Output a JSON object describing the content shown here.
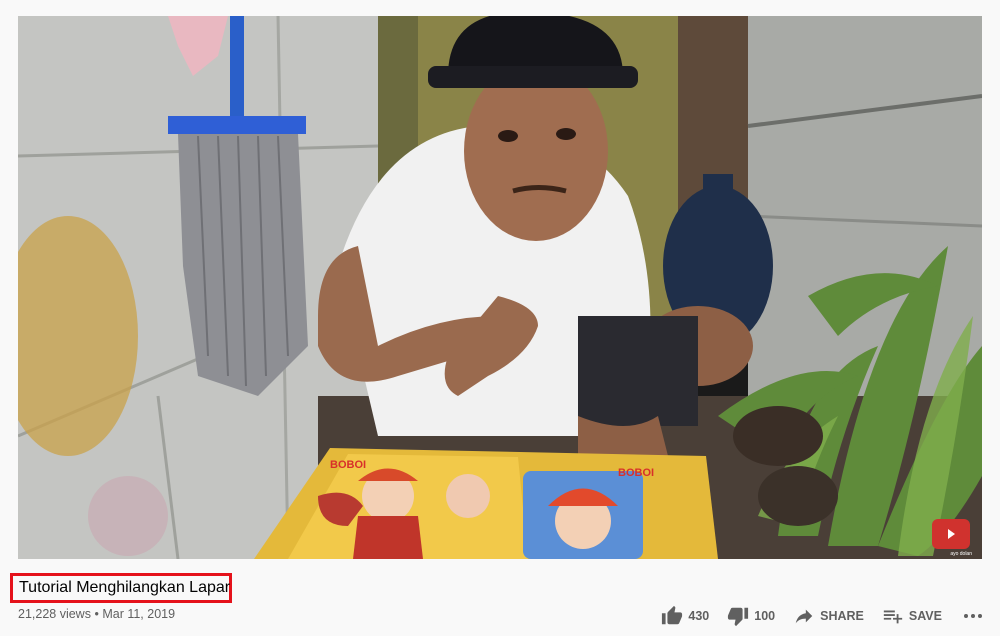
{
  "video": {
    "title": "Tutorial Menghilangkan Lapar",
    "views": "21,228 views",
    "separator": "•",
    "date": "Mar 11, 2019",
    "watermark_label": "ayo dolan",
    "thumbnail_text": {
      "left_logo": "BOBOI",
      "right_logo": "BOBOI"
    }
  },
  "actions": {
    "like_count": "430",
    "dislike_count": "100",
    "share_label": "SHARE",
    "save_label": "SAVE"
  },
  "icons": {
    "like": "thumb-up-icon",
    "dislike": "thumb-down-icon",
    "share": "share-arrow-icon",
    "save": "playlist-add-icon",
    "more": "more-horizontal-icon"
  },
  "colors": {
    "highlight_border": "#e5121b",
    "text_primary": "#030303",
    "text_secondary": "#606060",
    "background": "#f9f9f9"
  }
}
